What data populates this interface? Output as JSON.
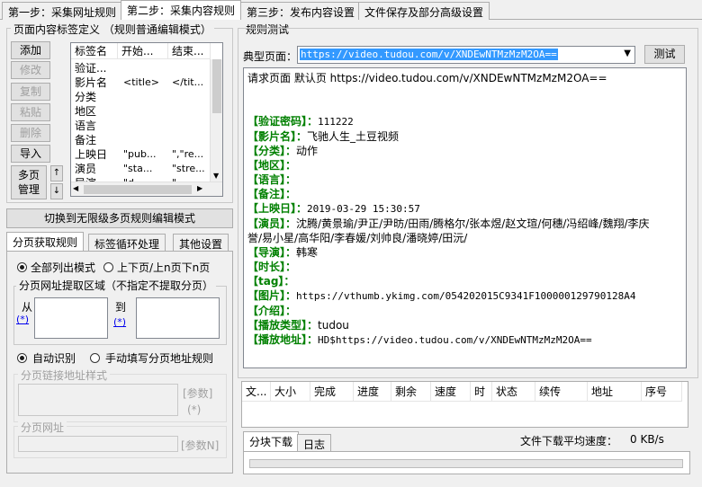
{
  "tabs": [
    {
      "label": "第一步：采集网址规则"
    },
    {
      "label": "第二步：采集内容规则"
    },
    {
      "label": "第三步：发布内容设置"
    },
    {
      "label": "文件保存及部分高级设置"
    }
  ],
  "tag_group": {
    "title": "页面内容标签定义 （规则普通编辑模式）",
    "buttons": {
      "add": "添加",
      "modify": "修改",
      "copy": "复制",
      "paste": "粘贴",
      "delete": "删除",
      "import": "导入",
      "paging_manage": "多页\n管理"
    },
    "columns": [
      "标签名",
      "开始...",
      "结束..."
    ],
    "rows": [
      [
        "验证...",
        "",
        ""
      ],
      [
        "影片名",
        "<title>",
        "</tit..."
      ],
      [
        "分类",
        "",
        ""
      ],
      [
        "地区",
        "",
        ""
      ],
      [
        "语言",
        "",
        ""
      ],
      [
        "备注",
        "",
        ""
      ],
      [
        "上映日",
        "\"pub...",
        "\",\"re..."
      ],
      [
        "演员",
        "\"sta...",
        "\"stre..."
      ],
      [
        "导演",
        "\"d...",
        "\"..."
      ]
    ]
  },
  "switch_mode_button": "切换到无限级多页规则编辑模式",
  "sub_tabs": [
    "分页获取规则",
    "标签循环处理",
    "其他设置"
  ],
  "paging": {
    "mode_all": "全部列出模式",
    "mode_updown": "上下页/上n页下n页",
    "extract_region_title": "分页网址提取区域（不指定不提取分页）",
    "from_label": "从",
    "to_label": "到",
    "star_link": "(*)",
    "auto_detect": "自动识别",
    "manual_rule": "手动填写分页地址规则",
    "link_style_title": "分页链接地址样式",
    "param_label": "[参数]",
    "param_star": "(*)",
    "page_url_title": "分页网址",
    "param_n": "[参数N]"
  },
  "rule_test": {
    "title": "规则测试",
    "typical_page_label": "典型页面：",
    "url_value": "https://video.tudou.com/v/XNDEwNTMzMzM2OA==",
    "test_button": "测试",
    "result_header": "请求页面 默认页 https://video.tudou.com/v/XNDEwNTMzMzM2OA==",
    "results": [
      {
        "key": "【验证密码】：",
        "value": "111222"
      },
      {
        "key": "【影片名】：",
        "value": "飞驰人生_土豆视频"
      },
      {
        "key": "【分类】：",
        "value": "动作"
      },
      {
        "key": "【地区】：",
        "value": ""
      },
      {
        "key": "【语言】：",
        "value": ""
      },
      {
        "key": "【备注】：",
        "value": ""
      },
      {
        "key": "【上映日】：",
        "value": "2019-03-29 15:30:57"
      },
      {
        "key": "【演员】：",
        "value": "沈腾/黄景瑜/尹正/尹昉/田雨/腾格尔/张本煜/赵文瑄/何穗/冯绍峰/魏翔/李庆"
      },
      {
        "key": "",
        "value": "誉/易小星/高华阳/李春媛/刘帅良/潘晓婷/田沅/"
      },
      {
        "key": "【导演】：",
        "value": "韩寒"
      },
      {
        "key": "【时长】：",
        "value": ""
      },
      {
        "key": "【tag】：",
        "value": ""
      },
      {
        "key": "【图片】：",
        "value": "https://vthumb.ykimg.com/054202015C9341F100000129790128A4"
      },
      {
        "key": "【介绍】：",
        "value": ""
      },
      {
        "key": "【播放类型】：",
        "value": "tudou"
      },
      {
        "key": "【播放地址】：",
        "value": "HD$https://video.tudou.com/v/XNDEwNTMzMzM2OA=="
      }
    ]
  },
  "download": {
    "columns": [
      "文...",
      "大小",
      "完成",
      "进度",
      "剩余",
      "速度",
      "时",
      "状态",
      "续传",
      "地址",
      "序号"
    ],
    "tabs": [
      "分块下载",
      "日志"
    ],
    "avg_speed_label": "文件下载平均速度：",
    "avg_speed_value": "0 KB/s"
  }
}
